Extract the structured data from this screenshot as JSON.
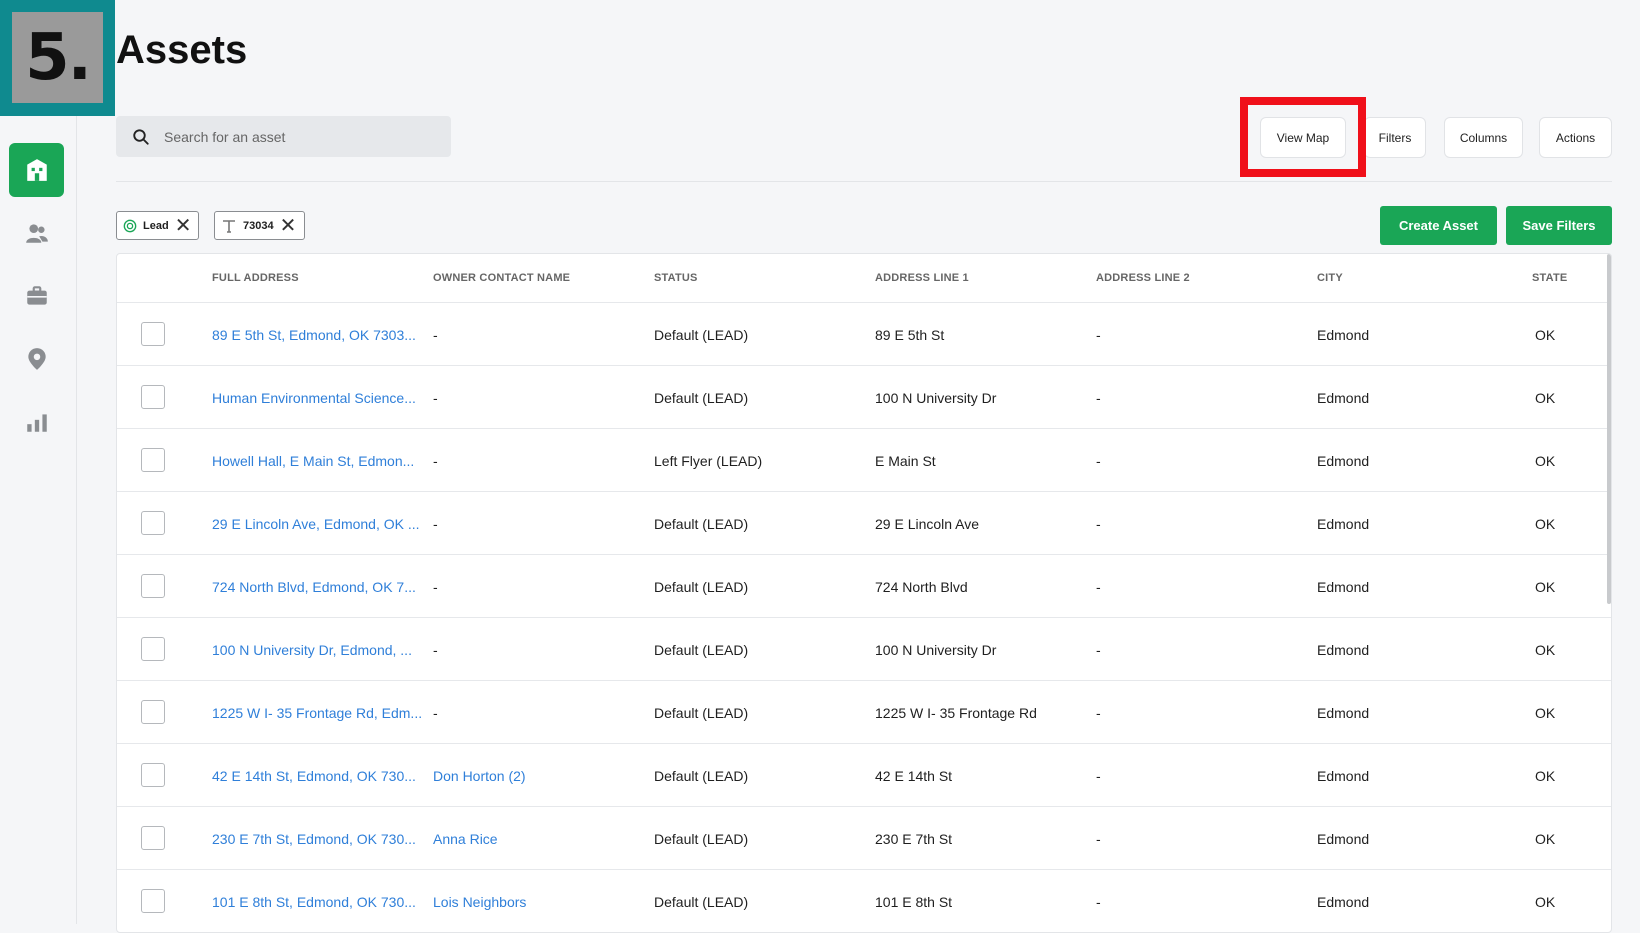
{
  "step_number": "5.",
  "page": {
    "title": "Assets"
  },
  "search": {
    "placeholder": "Search for an asset"
  },
  "toolbar": {
    "view_map": "View Map",
    "filters": "Filters",
    "columns": "Columns",
    "actions": "Actions",
    "create_asset": "Create Asset",
    "save_filters": "Save Filters"
  },
  "chips": [
    {
      "label": "Lead",
      "icon": "target-icon"
    },
    {
      "label": "73034",
      "icon": "text-icon"
    }
  ],
  "sidebar": {
    "items": [
      {
        "icon": "building-icon",
        "active": true
      },
      {
        "icon": "people-icon",
        "active": false
      },
      {
        "icon": "briefcase-icon",
        "active": false
      },
      {
        "icon": "map-pin-icon",
        "active": false
      },
      {
        "icon": "bar-chart-icon",
        "active": false
      }
    ]
  },
  "colors": {
    "accent": "#1aa656",
    "link": "#2f7fd9",
    "highlight": "#f0101a",
    "badge": "#0f8a8f"
  },
  "table": {
    "headers": [
      "FULL ADDRESS",
      "OWNER CONTACT NAME",
      "STATUS",
      "ADDRESS LINE 1",
      "ADDRESS LINE 2",
      "CITY",
      "STATE"
    ],
    "rows": [
      {
        "full_address": "89 E 5th St, Edmond, OK 7303...",
        "owner": "-",
        "status": "Default (LEAD)",
        "line1": "89 E 5th St",
        "line2": "-",
        "city": "Edmond",
        "state": "OK"
      },
      {
        "full_address": "Human Environmental Science...",
        "owner": "-",
        "status": "Default (LEAD)",
        "line1": "100 N University Dr",
        "line2": "-",
        "city": "Edmond",
        "state": "OK"
      },
      {
        "full_address": "Howell Hall, E Main St, Edmon...",
        "owner": "-",
        "status": "Left Flyer (LEAD)",
        "line1": "E Main St",
        "line2": "-",
        "city": "Edmond",
        "state": "OK"
      },
      {
        "full_address": "29 E Lincoln Ave, Edmond, OK ...",
        "owner": "-",
        "status": "Default (LEAD)",
        "line1": "29 E Lincoln Ave",
        "line2": "-",
        "city": "Edmond",
        "state": "OK"
      },
      {
        "full_address": "724 North Blvd, Edmond, OK 7...",
        "owner": "-",
        "status": "Default (LEAD)",
        "line1": "724 North Blvd",
        "line2": "-",
        "city": "Edmond",
        "state": "OK"
      },
      {
        "full_address": "100 N University Dr, Edmond, ...",
        "owner": "-",
        "status": "Default (LEAD)",
        "line1": "100 N University Dr",
        "line2": "-",
        "city": "Edmond",
        "state": "OK"
      },
      {
        "full_address": "1225 W I- 35 Frontage Rd, Edm...",
        "owner": "-",
        "status": "Default (LEAD)",
        "line1": "1225 W I- 35 Frontage Rd",
        "line2": "-",
        "city": "Edmond",
        "state": "OK"
      },
      {
        "full_address": "42 E 14th St, Edmond, OK 730...",
        "owner": "Don Horton (2)",
        "status": "Default (LEAD)",
        "line1": "42 E 14th St",
        "line2": "-",
        "city": "Edmond",
        "state": "OK"
      },
      {
        "full_address": "230 E 7th St, Edmond, OK 730...",
        "owner": "Anna Rice",
        "status": "Default (LEAD)",
        "line1": "230 E 7th St",
        "line2": "-",
        "city": "Edmond",
        "state": "OK"
      },
      {
        "full_address": "101 E 8th St, Edmond, OK 730...",
        "owner": "Lois Neighbors",
        "status": "Default (LEAD)",
        "line1": "101 E 8th St",
        "line2": "-",
        "city": "Edmond",
        "state": "OK"
      }
    ]
  }
}
